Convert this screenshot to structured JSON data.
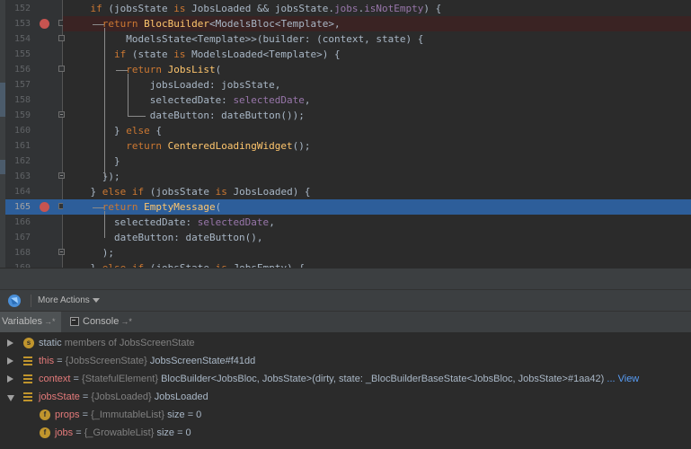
{
  "editor": {
    "lines": [
      {
        "num": "152",
        "code": [
          {
            "t": "    "
          },
          {
            "t": "if",
            "c": "kw"
          },
          {
            "t": " (jobsState "
          },
          {
            "t": "is",
            "c": "kw"
          },
          {
            "t": " JobsLoaded && jobsState."
          },
          {
            "t": "jobs",
            "c": "fld"
          },
          {
            "t": "."
          },
          {
            "t": "isNotEmpty",
            "c": "fld"
          },
          {
            "t": ") {"
          }
        ]
      },
      {
        "num": "153",
        "breakpoint": true,
        "fold": "start",
        "code": [
          {
            "t": "      "
          },
          {
            "t": "return ",
            "c": "kw"
          },
          {
            "t": "BlocBuilder",
            "c": "fn"
          },
          {
            "t": "<ModelsBloc<Template>,"
          }
        ]
      },
      {
        "num": "154",
        "fold": "start",
        "code": [
          {
            "t": "          ModelsState<Template>>(builder: (context, state) {"
          }
        ]
      },
      {
        "num": "155",
        "code": [
          {
            "t": "        "
          },
          {
            "t": "if",
            "c": "kw"
          },
          {
            "t": " (state "
          },
          {
            "t": "is",
            "c": "kw"
          },
          {
            "t": " ModelsLoaded<Template>) {"
          }
        ]
      },
      {
        "num": "156",
        "fold": "start",
        "code": [
          {
            "t": "          "
          },
          {
            "t": "return ",
            "c": "kw"
          },
          {
            "t": "JobsList",
            "c": "fn"
          },
          {
            "t": "("
          }
        ]
      },
      {
        "num": "157",
        "code": [
          {
            "t": "              jobsLoaded: jobsState,"
          }
        ]
      },
      {
        "num": "158",
        "code": [
          {
            "t": "              selectedDate: "
          },
          {
            "t": "selectedDate",
            "c": "fld"
          },
          {
            "t": ","
          }
        ]
      },
      {
        "num": "159",
        "fold": "end",
        "code": [
          {
            "t": "              dateButton: dateButton());"
          }
        ]
      },
      {
        "num": "160",
        "code": [
          {
            "t": "        } "
          },
          {
            "t": "else",
            "c": "kw"
          },
          {
            "t": " {"
          }
        ]
      },
      {
        "num": "161",
        "code": [
          {
            "t": "          "
          },
          {
            "t": "return ",
            "c": "kw"
          },
          {
            "t": "CenteredLoadingWidget",
            "c": "fn"
          },
          {
            "t": "();"
          }
        ]
      },
      {
        "num": "162",
        "code": [
          {
            "t": "        }"
          }
        ]
      },
      {
        "num": "163",
        "fold": "end",
        "code": [
          {
            "t": "      });"
          }
        ]
      },
      {
        "num": "164",
        "code": [
          {
            "t": "    } "
          },
          {
            "t": "else if",
            "c": "kw"
          },
          {
            "t": " (jobsState "
          },
          {
            "t": "is",
            "c": "kw"
          },
          {
            "t": " JobsLoaded) {"
          }
        ]
      },
      {
        "num": "165",
        "breakpoint": true,
        "exec": true,
        "fold": "start",
        "code": [
          {
            "t": "      "
          },
          {
            "t": "return ",
            "c": "kw"
          },
          {
            "t": "EmptyMessage",
            "c": "fn"
          },
          {
            "t": "("
          }
        ]
      },
      {
        "num": "166",
        "code": [
          {
            "t": "        selectedDate: "
          },
          {
            "t": "selectedDate",
            "c": "fld"
          },
          {
            "t": ","
          }
        ]
      },
      {
        "num": "167",
        "code": [
          {
            "t": "        dateButton: dateButton(),"
          }
        ]
      },
      {
        "num": "168",
        "fold": "end",
        "code": [
          {
            "t": "      );"
          }
        ]
      },
      {
        "num": "169",
        "code": [
          {
            "t": "    } "
          },
          {
            "t": "else if",
            "c": "kw"
          },
          {
            "t": " (jobsState "
          },
          {
            "t": "is",
            "c": "kw"
          },
          {
            "t": " JobsEmpty) {"
          }
        ]
      }
    ]
  },
  "toolbar": {
    "more_actions": "More Actions",
    "dart_icon": "dart-devtools-icon"
  },
  "tabs": {
    "variables": "Variables",
    "console": "Console",
    "pin": "→*"
  },
  "variables": [
    {
      "expand": "collapsed",
      "icon": "static",
      "name": "static",
      "name_style": "plain",
      "rest": " members of JobsScreenState",
      "rest_style": "type"
    },
    {
      "expand": "collapsed",
      "icon": "list",
      "name": "this",
      "eq": " = ",
      "type": "{JobsScreenState} ",
      "value": "JobsScreenState#f41dd"
    },
    {
      "expand": "collapsed",
      "icon": "list",
      "name": "context",
      "eq": " = ",
      "type": "{StatefulElement} ",
      "value": "BlocBuilder<JobsBloc, JobsState>(dirty, state: _BlocBuilderBaseState<JobsBloc, JobsState>#1aa42)",
      "link": " ... View"
    },
    {
      "expand": "expanded",
      "icon": "list",
      "name": "jobsState",
      "eq": " = ",
      "type": "{JobsLoaded} ",
      "value": "JobsLoaded"
    },
    {
      "expand": "none",
      "indent": 1,
      "icon": "field",
      "name": "props",
      "eq": " = ",
      "type": "{_ImmutableList} ",
      "value": "size = 0"
    },
    {
      "expand": "none",
      "indent": 1,
      "icon": "field",
      "name": "jobs",
      "eq": " = ",
      "type": "{_GrowableList} ",
      "value": "size = 0"
    }
  ]
}
